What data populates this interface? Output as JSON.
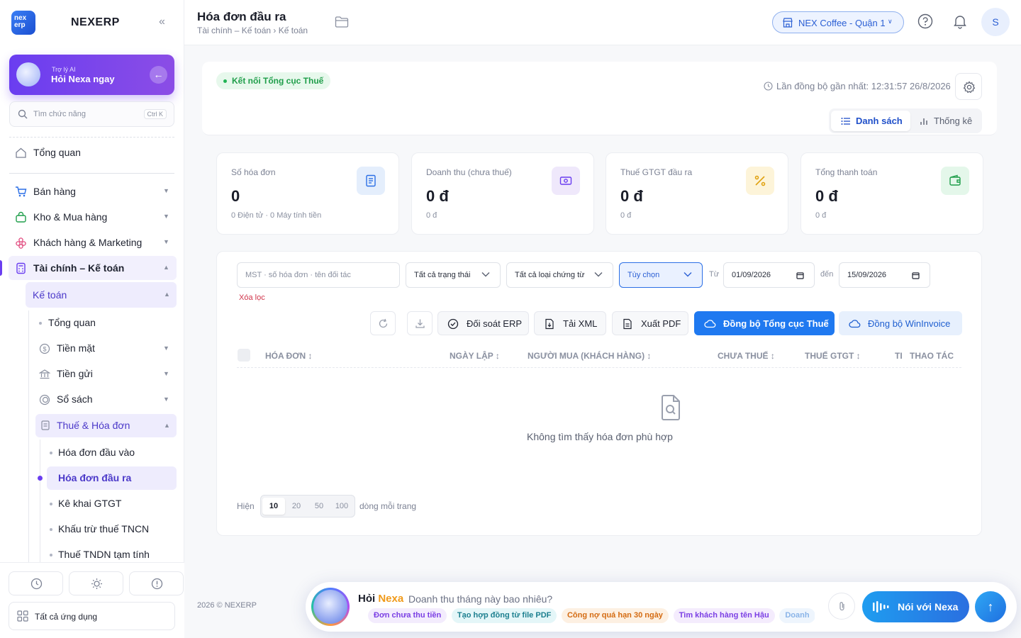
{
  "sidebar": {
    "logo_text_1": "nex",
    "logo_text_2": "erp",
    "brand": "NEXERP",
    "collapse_icon": "«",
    "ai_card": {
      "small": "Trợ lý AI",
      "big": "Hỏi Nexa ngay"
    },
    "search": {
      "placeholder": "Tìm chức năng",
      "shortcut": "Ctrl K"
    },
    "overview": "Tổng quan",
    "groups": [
      {
        "label": "Bán hàng"
      },
      {
        "label": "Kho & Mua hàng"
      },
      {
        "label": "Khách hàng & Marketing"
      },
      {
        "label": "Tài chính – Kế toán"
      }
    ],
    "accounting": {
      "label": "Kế toán",
      "items": [
        {
          "label": "Tổng quan"
        },
        {
          "label": "Tiền mặt"
        },
        {
          "label": "Tiền gửi"
        },
        {
          "label": "Sổ sách"
        }
      ],
      "tax": {
        "label": "Thuế & Hóa đơn",
        "items": [
          {
            "label": "Hóa đơn đầu vào"
          },
          {
            "label": "Hóa đơn đầu ra"
          },
          {
            "label": "Kê khai GTGT"
          },
          {
            "label": "Khấu trừ thuế TNCN"
          },
          {
            "label": "Thuế TNDN tạm tính"
          }
        ]
      }
    },
    "all_apps": "Tất cả ứng dụng"
  },
  "header": {
    "title": "Hóa đơn đầu ra",
    "breadcrumb": "Tài chính – Kế toán › Kế toán",
    "store": "NEX Coffee - Quận 1",
    "avatar": "S"
  },
  "top": {
    "status": "Kết nối Tổng cục Thuế",
    "last_sync": "Lần đồng bộ gần nhất: 12:31:57 26/8/2026",
    "tabs": [
      "Danh sách",
      "Thống kê"
    ]
  },
  "stats": [
    {
      "title": "Số hóa đơn",
      "value": "0",
      "sub": "0 Điện tử · 0 Máy tính tiền",
      "color": "#e4eefc"
    },
    {
      "title": "Doanh thu (chưa thuế)",
      "value": "0 đ",
      "sub": "0 đ",
      "color": "#efe8fb"
    },
    {
      "title": "Thuế GTGT đầu ra",
      "value": "0 đ",
      "sub": "0 đ",
      "color": "#fdf4d9"
    },
    {
      "title": "Tổng thanh toán",
      "value": "0 đ",
      "sub": "0 đ",
      "color": "#e4f7ea"
    }
  ],
  "filters": {
    "search_placeholder": "MST · số hóa đơn · tên đối tác",
    "status": "Tất cả trạng thái",
    "doc_type": "Tất cả loại chứng từ",
    "range": "Tùy chọn",
    "from_label": "Từ",
    "from": "01/09/2026",
    "to_label": "đến",
    "to": "15/09/2026",
    "clear": "Xóa lọc"
  },
  "actions": {
    "reconcile": "Đối soát ERP",
    "xml": "Tải XML",
    "pdf": "Xuất PDF",
    "sync_tax": "Đồng bộ Tổng cục Thuế",
    "sync_wininvoice": "Đồng bộ WinInvoice"
  },
  "table": {
    "columns": [
      "HÓA ĐƠN",
      "NGÀY LẬP",
      "NGƯỜI MUA (KHÁCH HÀNG)",
      "CHƯA THUẾ",
      "THUẾ GTGT",
      "TI",
      "THAO TÁC"
    ],
    "empty": "Không tìm thấy hóa đơn phù hợp"
  },
  "pager": {
    "show": "Hiện",
    "sizes": [
      "10",
      "20",
      "50",
      "100"
    ],
    "per_page": "dòng mỗi trang"
  },
  "footer": "2026 © NEXERP",
  "chat": {
    "ask": "Hỏi",
    "name": "Nexa",
    "question": "Doanh thu tháng này bao nhiêu?",
    "chips": [
      "Đơn chưa thu tiền",
      "Tạo hợp đồng từ file PDF",
      "Công nợ quá hạn 30 ngày",
      "Tìm khách hàng tên Hậu",
      "Doanh"
    ],
    "talk": "Nói với Nexa",
    "send": "↑"
  }
}
